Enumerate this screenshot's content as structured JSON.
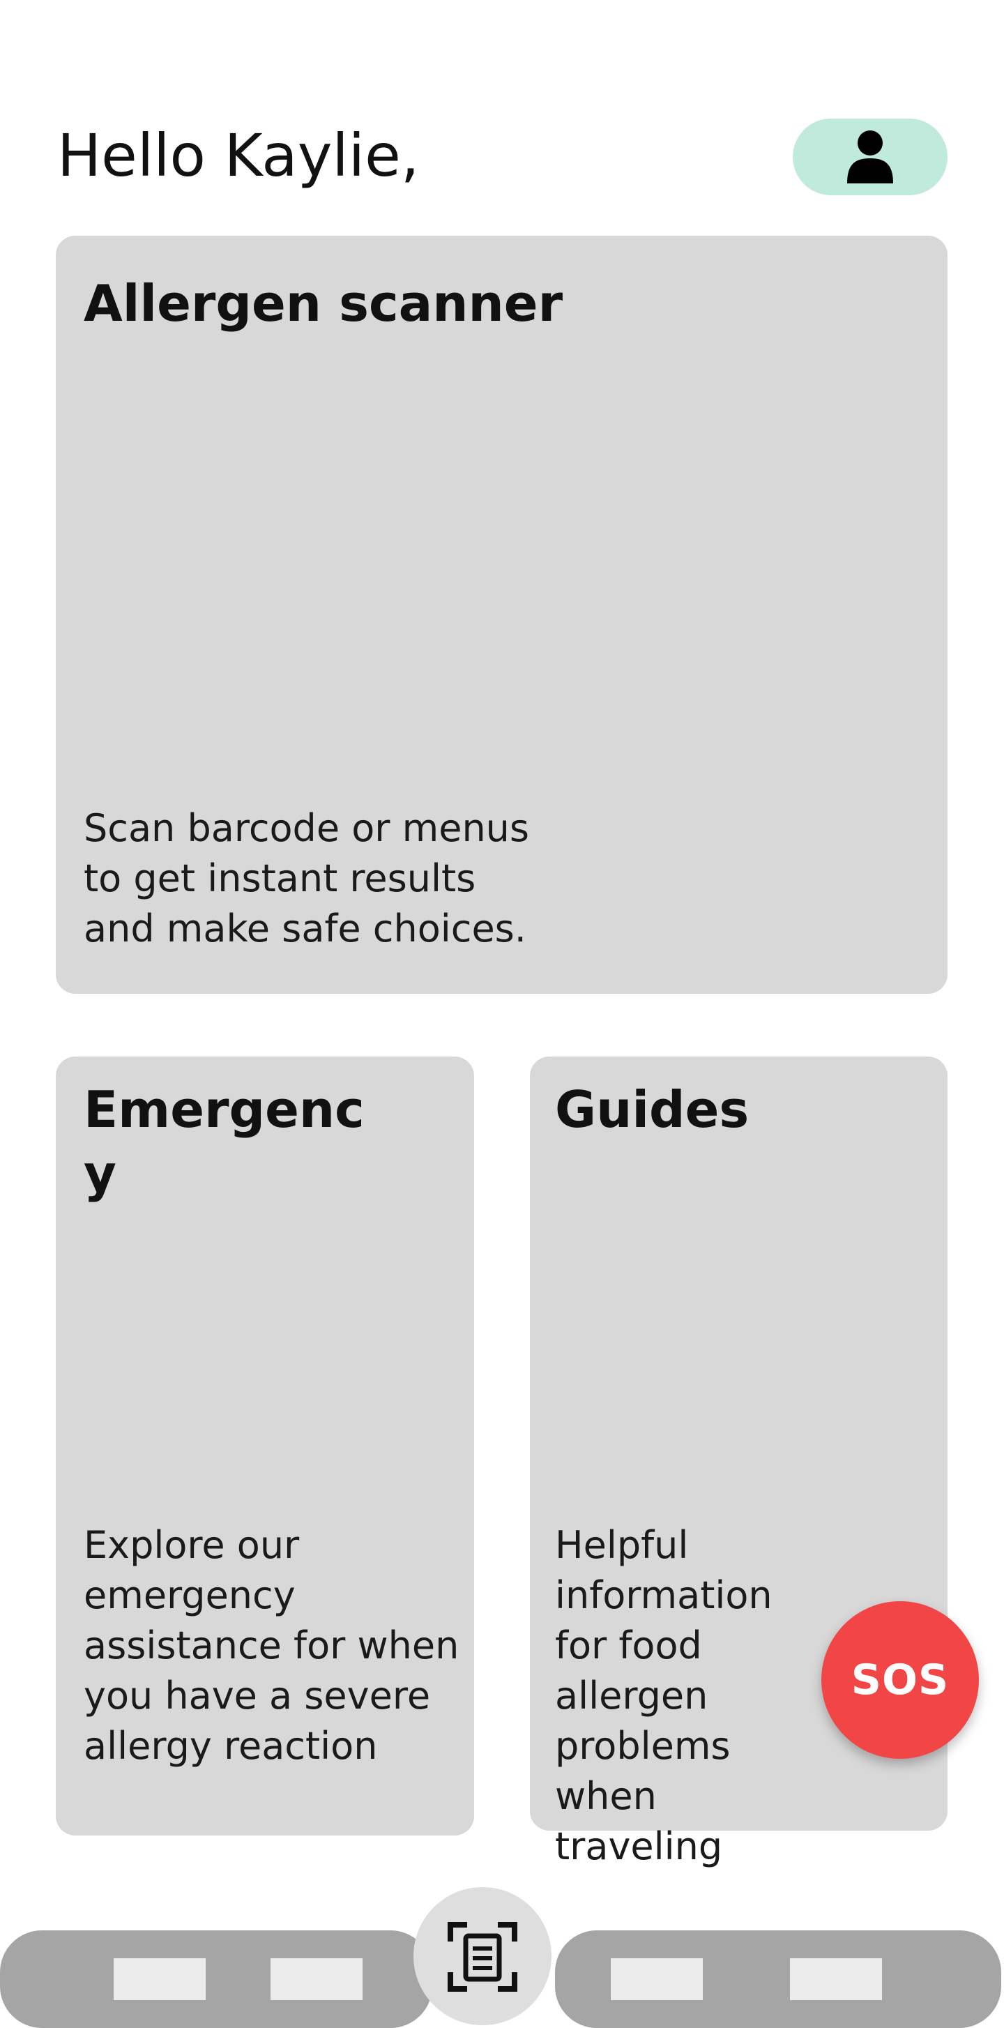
{
  "header": {
    "greeting": "Hello Kaylie,"
  },
  "profile": {
    "icon": "user-icon",
    "background": "#c0eadb"
  },
  "cards": {
    "scanner": {
      "title": "Allergen scanner",
      "description": "Scan barcode or menus to get instant results and make safe choices."
    },
    "emergency": {
      "title": "Emergency",
      "description": "Explore our emergency assistance for when you have a severe allergy reaction"
    },
    "guides": {
      "title": "Guides",
      "description": "Helpful information for food allergen problems when traveling"
    }
  },
  "sos": {
    "label": "SOS",
    "color": "#f24646"
  },
  "bottom_nav": {
    "scan_icon": "document-scan-icon",
    "background": "#a5a5a5"
  }
}
